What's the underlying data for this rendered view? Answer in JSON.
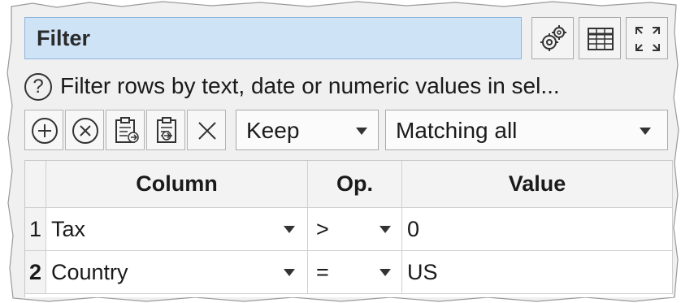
{
  "panel": {
    "title": "Filter",
    "title_buttons": [
      {
        "name": "settings-button",
        "icon": "gears-icon"
      },
      {
        "name": "table-view-button",
        "icon": "table-icon"
      },
      {
        "name": "maximize-button",
        "icon": "expand-arrows-icon"
      }
    ]
  },
  "help": {
    "icon": "question-circle-icon",
    "text": "Filter rows by text, date or numeric values in sel..."
  },
  "toolbar": {
    "buttons": [
      {
        "name": "add-row-button",
        "icon": "plus-circle-icon"
      },
      {
        "name": "remove-row-button",
        "icon": "x-circle-icon"
      },
      {
        "name": "paste-button",
        "icon": "clipboard-in-icon"
      },
      {
        "name": "copy-button",
        "icon": "clipboard-out-icon"
      },
      {
        "name": "clear-button",
        "icon": "close-icon"
      }
    ],
    "mode": {
      "value": "Keep"
    },
    "match": {
      "value": "Matching all"
    }
  },
  "table": {
    "headers": [
      "Column",
      "Op.",
      "Value"
    ],
    "rows": [
      {
        "num": "1",
        "column": "Tax",
        "op": ">",
        "value": "0"
      },
      {
        "num": "2",
        "column": "Country",
        "op": "=",
        "value": "US"
      }
    ]
  },
  "colors": {
    "title_bg": "#cfe3f7",
    "panel_bg": "#f0f0f0",
    "header_bg": "#f3f3f3"
  }
}
